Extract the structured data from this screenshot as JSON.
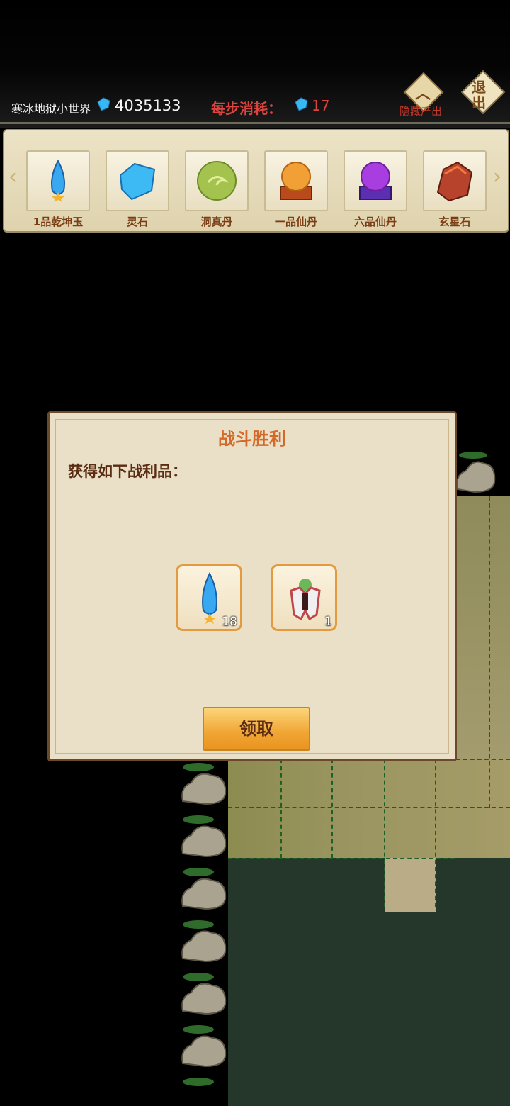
{
  "hud": {
    "world_name": "寒冰地狱小世界",
    "stone_count": "4035133",
    "cost_label": "每步消耗：",
    "cost_value": "17",
    "hide_label": "隐藏产出",
    "exit_label": "退出"
  },
  "strip": {
    "items": [
      {
        "label": "1品乾坤玉",
        "icon": "blue-crystal-icon"
      },
      {
        "label": "灵石",
        "icon": "spirit-stone-icon"
      },
      {
        "label": "洞真丹",
        "icon": "green-pill-icon"
      },
      {
        "label": "一品仙丹",
        "icon": "orange-orb-icon"
      },
      {
        "label": "六品仙丹",
        "icon": "purple-orb-icon"
      },
      {
        "label": "玄星石",
        "icon": "red-ore-icon"
      }
    ]
  },
  "dialog": {
    "title": "战斗胜利",
    "message": "获得如下战利品：",
    "rewards": [
      {
        "icon": "blue-crystal-icon",
        "count": "18"
      },
      {
        "icon": "character-figure-icon",
        "count": "1"
      }
    ],
    "claim_label": "领取"
  },
  "colors": {
    "accent_red": "#d9443f",
    "title_orange": "#d46a2a",
    "button_gold": "#f0a533"
  }
}
